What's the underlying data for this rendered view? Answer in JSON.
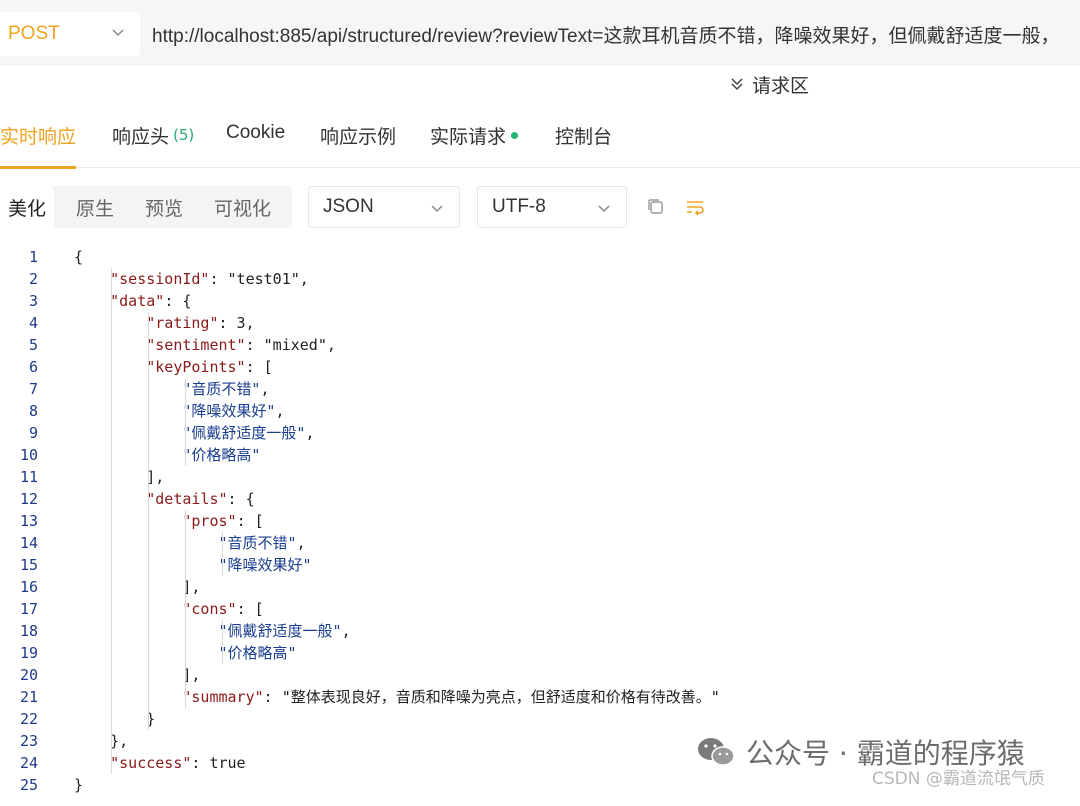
{
  "request": {
    "method": "POST",
    "url": "http://localhost:885/api/structured/review?reviewText=这款耳机音质不错，降噪效果好，但佩戴舒适度一般，",
    "section_toggle": "请求区"
  },
  "response_tabs": [
    {
      "label": "实时响应",
      "active": true
    },
    {
      "label": "响应头",
      "count": "(5)"
    },
    {
      "label": "Cookie"
    },
    {
      "label": "响应示例"
    },
    {
      "label": "实际请求",
      "dot": true
    },
    {
      "label": "控制台"
    }
  ],
  "toolbar": {
    "formats": [
      "美化",
      "原生",
      "预览",
      "可视化"
    ],
    "active_format": "美化",
    "content_type": "JSON",
    "encoding": "UTF-8"
  },
  "code_lines": [
    {
      "n": "1",
      "t": "{"
    },
    {
      "n": "2",
      "t": "    \"sessionId\": \"test01\","
    },
    {
      "n": "3",
      "t": "    \"data\": {"
    },
    {
      "n": "4",
      "t": "        \"rating\": 3,"
    },
    {
      "n": "5",
      "t": "        \"sentiment\": \"mixed\","
    },
    {
      "n": "6",
      "t": "        \"keyPoints\": ["
    },
    {
      "n": "7",
      "t": "            \"音质不错\","
    },
    {
      "n": "8",
      "t": "            \"降噪效果好\","
    },
    {
      "n": "9",
      "t": "            \"佩戴舒适度一般\","
    },
    {
      "n": "10",
      "t": "            \"价格略高\""
    },
    {
      "n": "11",
      "t": "        ],"
    },
    {
      "n": "12",
      "t": "        \"details\": {"
    },
    {
      "n": "13",
      "t": "            \"pros\": ["
    },
    {
      "n": "14",
      "t": "                \"音质不错\","
    },
    {
      "n": "15",
      "t": "                \"降噪效果好\""
    },
    {
      "n": "16",
      "t": "            ],"
    },
    {
      "n": "17",
      "t": "            \"cons\": ["
    },
    {
      "n": "18",
      "t": "                \"佩戴舒适度一般\","
    },
    {
      "n": "19",
      "t": "                \"价格略高\""
    },
    {
      "n": "20",
      "t": "            ],"
    },
    {
      "n": "21",
      "t": "            \"summary\": \"整体表现良好，音质和降噪为亮点，但舒适度和价格有待改善。\""
    },
    {
      "n": "22",
      "t": "        }"
    },
    {
      "n": "23",
      "t": "    },"
    },
    {
      "n": "24",
      "t": "    \"success\": true"
    },
    {
      "n": "25",
      "t": "}"
    }
  ],
  "watermark": {
    "main": "公众号 · 霸道的程序猿",
    "sub": "CSDN @霸道流氓气质"
  },
  "colors": {
    "accent": "#f0a321",
    "json_key": "#8b1a1a",
    "json_value": "#1a3d8f",
    "status_dot": "#22b573"
  }
}
